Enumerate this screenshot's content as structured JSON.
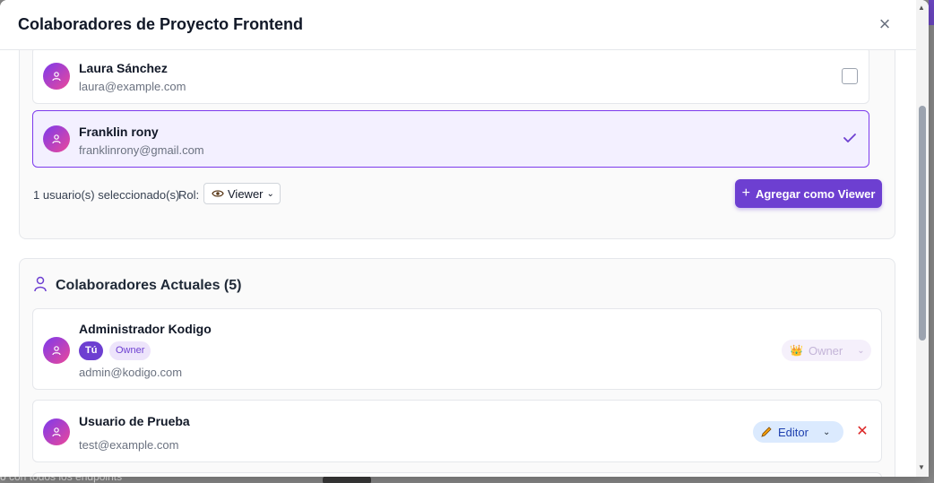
{
  "backdrop": {
    "text": "o con todos los endpoints"
  },
  "modal": {
    "title": "Colaboradores de Proyecto Frontend",
    "close_glyph": "×"
  },
  "add_section": {
    "users": [
      {
        "name": "Laura Sánchez",
        "email": "laura@example.com",
        "selected": false
      },
      {
        "name": "Franklin rony",
        "email": "franklinrony@gmail.com",
        "selected": true
      }
    ],
    "selected_count_text": "1 usuario(s) seleccionado(s)",
    "role_label": "Rol:",
    "role_value": "Viewer",
    "add_button_label": "Agregar como Viewer"
  },
  "current_section": {
    "title": "Colaboradores Actuales (5)",
    "collaborators": [
      {
        "name": "Administrador Kodigo",
        "email": "admin@kodigo.com",
        "badge_you": "Tú",
        "badge_role": "Owner",
        "role": "Owner",
        "role_icon": "crown-icon"
      },
      {
        "name": "Usuario de Prueba",
        "email": "test@example.com",
        "role": "Editor",
        "role_icon": "pencil-icon",
        "remove_glyph": "✕"
      }
    ]
  },
  "colors": {
    "accent": "#6d3fd1",
    "avatar_from": "#7c3aed",
    "avatar_to": "#ec4899",
    "danger": "#dc2626",
    "editor_bg": "#dbeafe"
  }
}
